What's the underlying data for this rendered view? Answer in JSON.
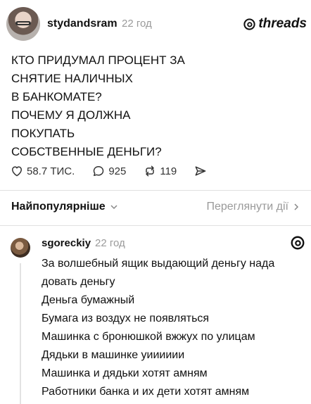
{
  "post": {
    "author": "stydandsram",
    "time": "22 год",
    "brand": "threads",
    "lines": [
      "КТО ПРИДУМАЛ ПРОЦЕНТ ЗА",
      "СНЯТИЕ НАЛИЧНЫХ",
      "В БАНКОМАТЕ?",
      "ПОЧЕМУ Я ДОЛЖНА",
      "ПОКУПАТЬ",
      "СОБСТВЕННЫЕ ДЕНЬГИ?"
    ],
    "likes": "58.7 ТИС.",
    "comments": "925",
    "reposts": "119"
  },
  "sort": {
    "label": "Найпопулярніше",
    "view_activity": "Переглянути дії"
  },
  "reply": {
    "author": "sgoreckiy",
    "time": "22 год",
    "lines": [
      "За волшебный ящик выдающий деньгу нада",
      "довать деньгу",
      "Деньга бумажный",
      "Бумага из воздух не появляться",
      "Машинка с бронюшкой вжжух по улицам",
      "Дядьки в машинке уииииии",
      "Машинка и дядьки хотят амням",
      "Работники банка и их дети хотят амням"
    ]
  }
}
